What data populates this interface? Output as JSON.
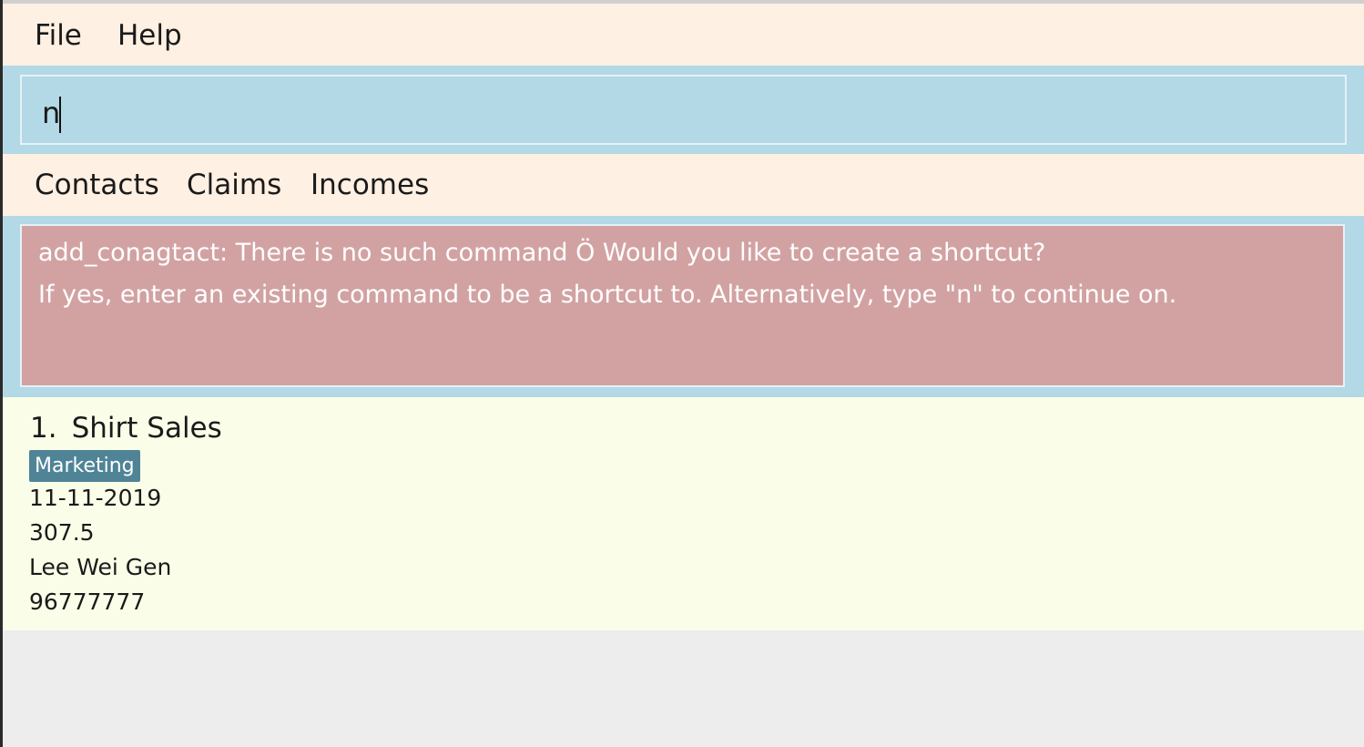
{
  "menubar": {
    "items": [
      {
        "label": "File"
      },
      {
        "label": "Help"
      }
    ]
  },
  "command_box": {
    "value": "n"
  },
  "tabs": [
    {
      "label": "Contacts"
    },
    {
      "label": "Claims"
    },
    {
      "label": "Incomes"
    }
  ],
  "result_display": {
    "lines": [
      "add_conagtact: There is no such command Ö Would you like to create a shortcut?",
      "If yes, enter an existing command to be a shortcut to. Alternatively, type \"n\" to continue on."
    ]
  },
  "list": {
    "items": [
      {
        "index": "1.",
        "description": "Shirt Sales",
        "tag": "Marketing",
        "date": "11-11-2019",
        "amount": "307.5",
        "name": "Lee Wei Gen",
        "phone": "96777777"
      }
    ]
  },
  "colors": {
    "menubar_bg": "#fef0e2",
    "command_bg": "#b3d8e6",
    "result_bg": "#d2a2a3",
    "list_bg": "#fafee8",
    "tag_bg": "#4f8497",
    "window_bg": "#ededed"
  }
}
